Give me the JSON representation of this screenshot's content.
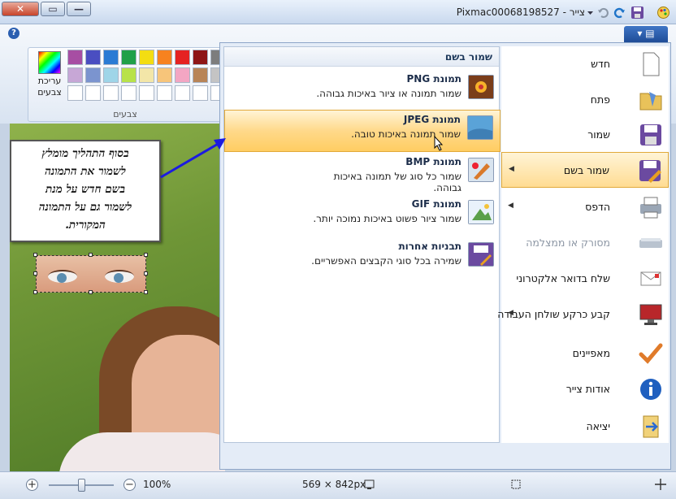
{
  "window": {
    "title": "צייר - Pixmac00068198527",
    "close_glyph": "✕",
    "max_glyph": "▭",
    "min_glyph": "—"
  },
  "ribbon": {
    "help": "?",
    "app_button": "▾ ▤",
    "edit_colors_label": "עריכת צבעים",
    "colors_group_label": "צבעים",
    "palette": [
      "#a74ea3",
      "#4a4ec1",
      "#2a7bd4",
      "#20a048",
      "#f3dd12",
      "#f7821f",
      "#e52222",
      "#8e1515",
      "#7d7d7d",
      "#000000",
      "#c7a7d6",
      "#7b94cf",
      "#9ed5e8",
      "#b8e24a",
      "#f3e6a8",
      "#f7c57a",
      "#f3a6c3",
      "#b88457",
      "#c4c4c4",
      "#ffffff"
    ]
  },
  "callout": {
    "lines": [
      "בסוף התהליך מומלץ",
      "לשמור את התמונה",
      "בשם חדש על מנת",
      "לשמור גם על התמונה",
      "המקורית."
    ]
  },
  "save_as": {
    "header": "שמור בשם",
    "options": [
      {
        "title": "תמונת PNG",
        "desc": "שמור תמונה או ציור באיכות גבוהה.",
        "icon": "png-image-icon"
      },
      {
        "title": "תמונת JPEG",
        "desc": "שמור תמונה באיכות טובה.",
        "icon": "jpeg-image-icon"
      },
      {
        "title": "תמונת BMP",
        "desc": "שמור כל סוג של תמונה באיכות גבוהה.",
        "icon": "bmp-image-icon"
      },
      {
        "title": "תמונת GIF",
        "desc": "שמור ציור פשוט באיכות נמוכה יותר.",
        "icon": "gif-image-icon"
      },
      {
        "title": "תבניות אחרות",
        "desc": "שמירה בכל סוגי הקבצים האפשריים.",
        "icon": "other-formats-icon"
      }
    ]
  },
  "app_menu": {
    "items": [
      {
        "label": "חדש",
        "icon": "new-icon",
        "submenu": false,
        "enabled": true
      },
      {
        "label": "פתח",
        "icon": "open-folder-icon",
        "submenu": false,
        "enabled": true
      },
      {
        "label": "שמור",
        "icon": "save-icon",
        "submenu": false,
        "enabled": true
      },
      {
        "label": "שמור בשם",
        "icon": "save-as-icon",
        "submenu": true,
        "enabled": true
      },
      {
        "label": "הדפס",
        "icon": "print-icon",
        "submenu": true,
        "enabled": true
      },
      {
        "label": "מסורק או ממצלמה",
        "icon": "scanner-icon",
        "submenu": false,
        "enabled": false
      },
      {
        "label": "שלח בדואר אלקטרוני",
        "icon": "email-icon",
        "submenu": false,
        "enabled": true
      },
      {
        "label": "קבע כרקע שולחן העבודה",
        "icon": "desktop-background-icon",
        "submenu": true,
        "enabled": true
      },
      {
        "label": "מאפיינים",
        "icon": "properties-check-icon",
        "submenu": false,
        "enabled": true
      },
      {
        "label": "אודות צייר",
        "icon": "about-info-icon",
        "submenu": false,
        "enabled": true
      },
      {
        "label": "יציאה",
        "icon": "exit-icon",
        "submenu": false,
        "enabled": true
      }
    ]
  },
  "status": {
    "zoom": "100%",
    "zoom_level": 0.5,
    "image_size": "569 × 842px",
    "zoom_in": "+",
    "zoom_out": "−"
  },
  "colors": {
    "accent": "#ffd98a",
    "menu_border": "#8ea6c8"
  }
}
